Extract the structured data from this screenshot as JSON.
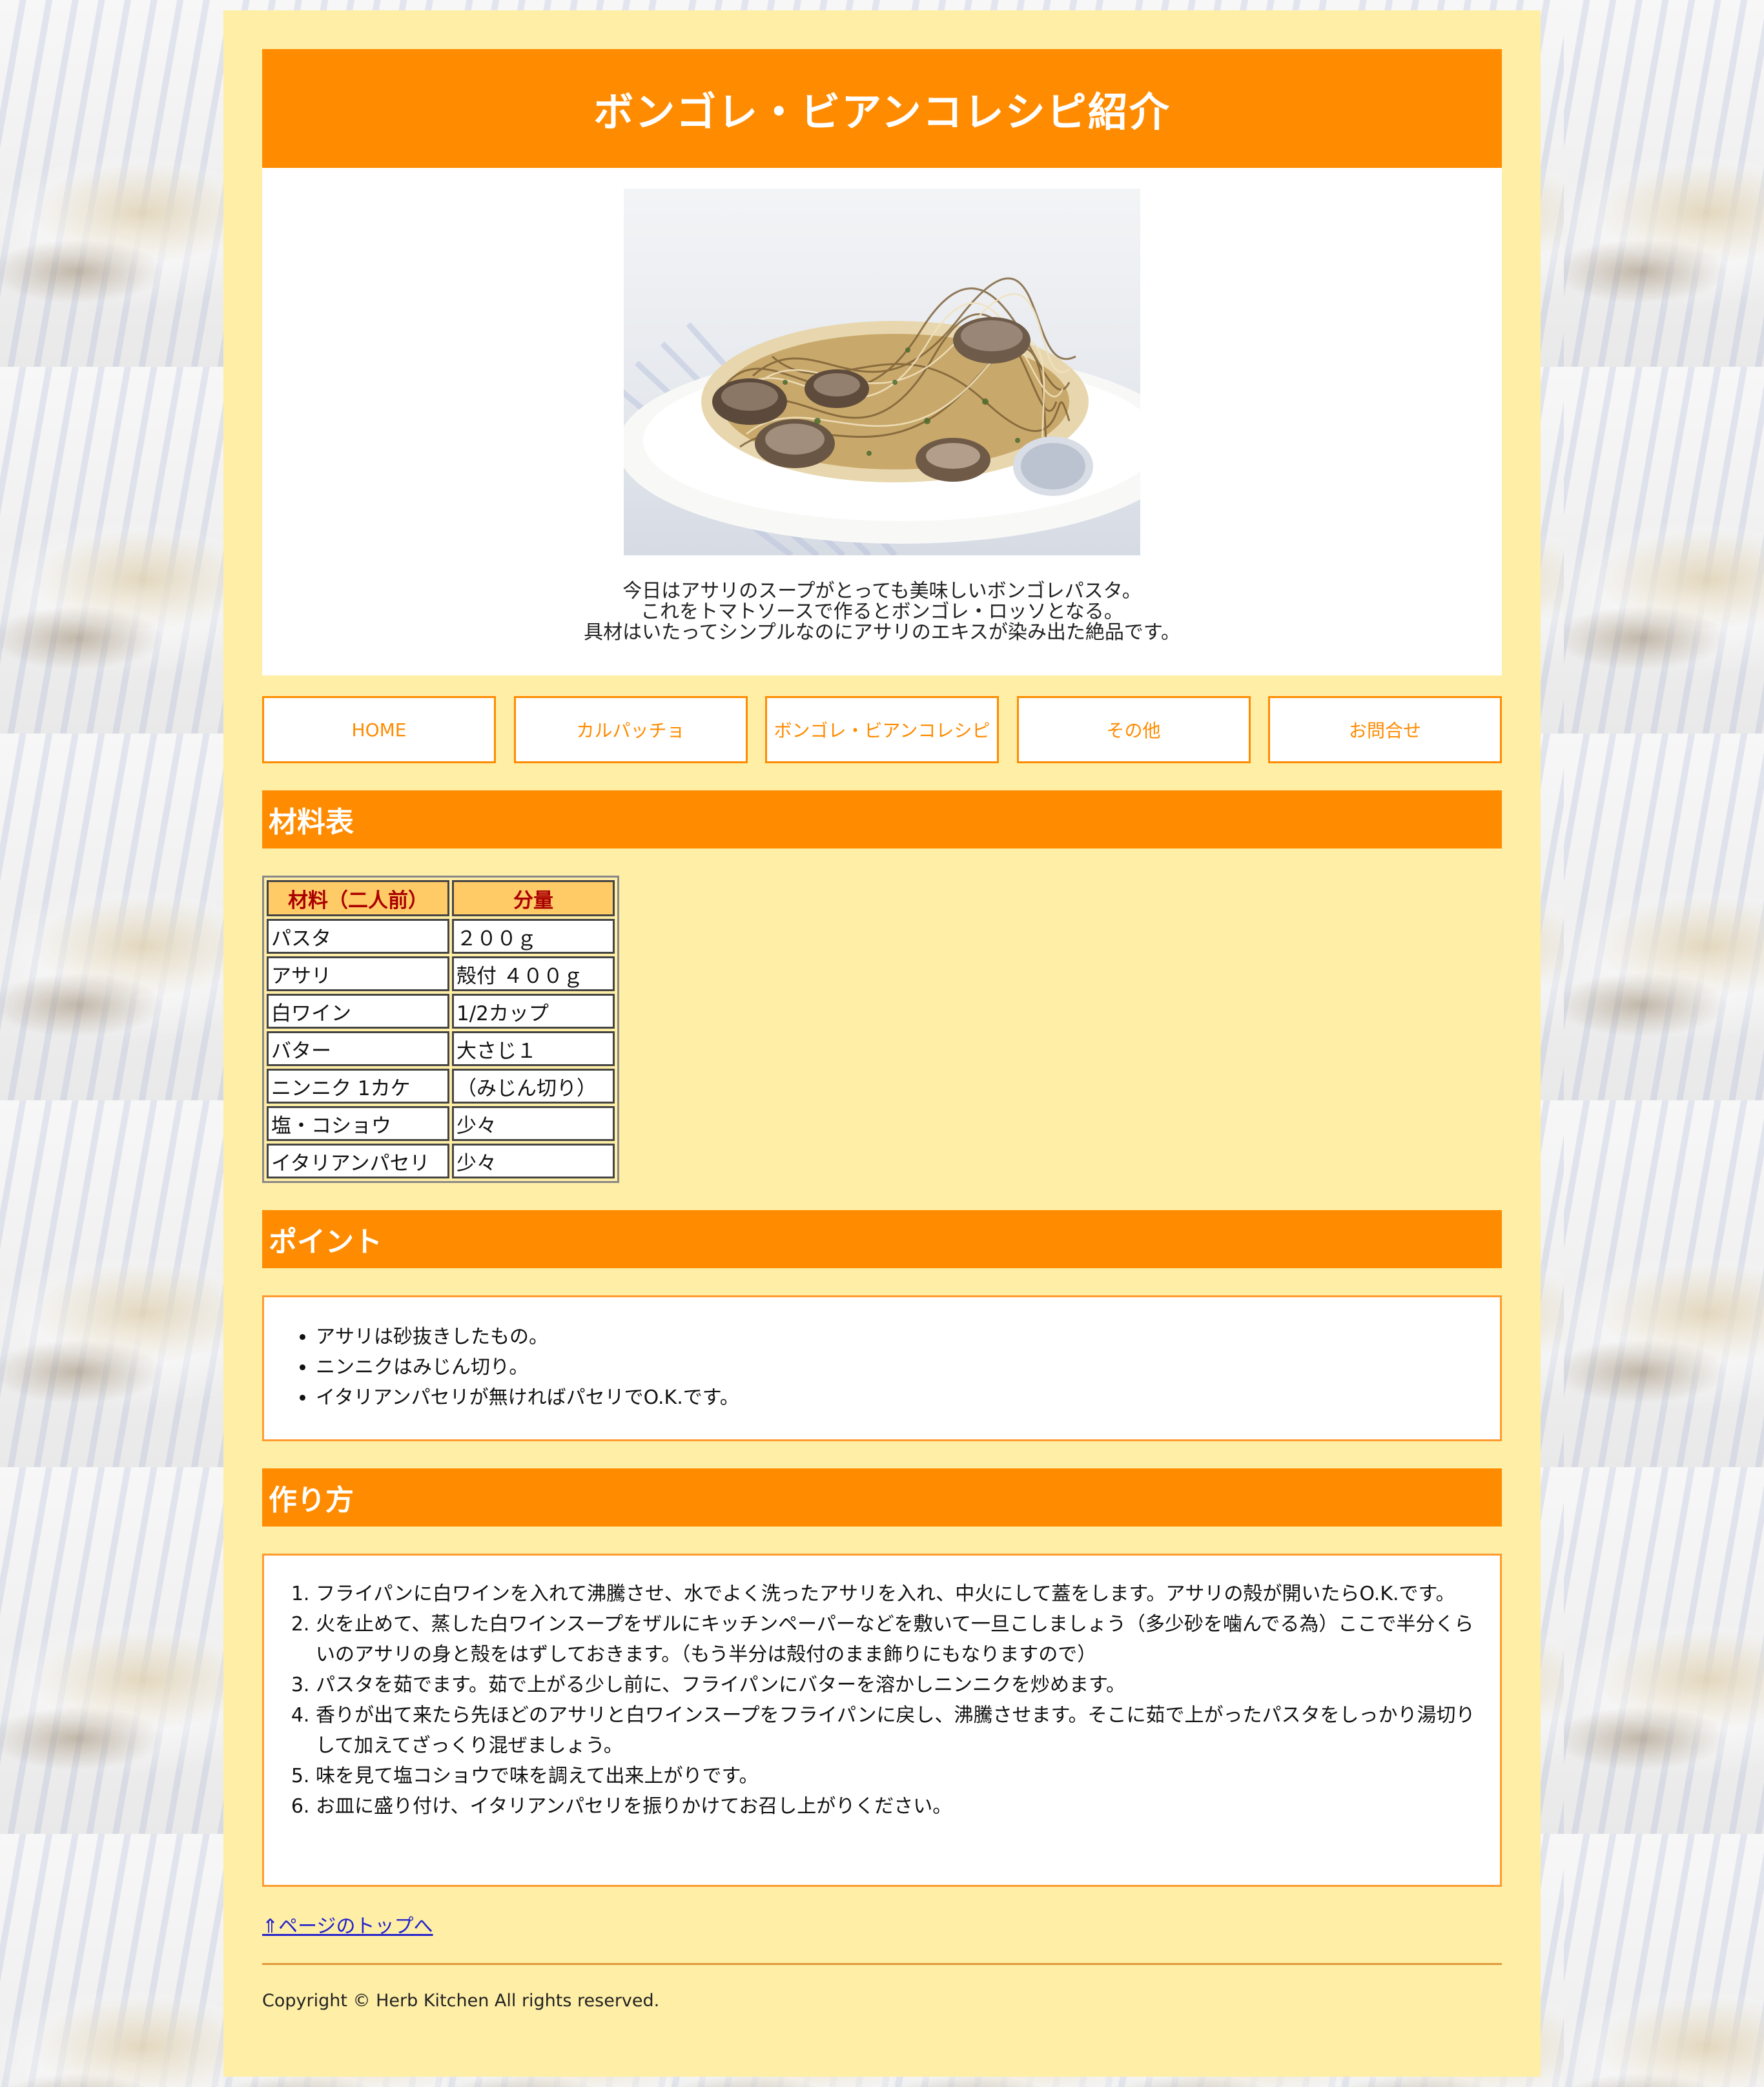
{
  "header": {
    "title": "ボンゴレ・ビアンコレシピ紹介"
  },
  "intro": {
    "lines": [
      "今日はアサリのスープがとっても美味しいボンゴレパスタ。",
      "これをトマトソースで作るとボンゴレ・ロッソとなる。",
      "具材はいたってシンプルなのにアサリのエキスが染み出た絶品です。"
    ]
  },
  "nav": {
    "items": [
      "HOME",
      "カルパッチョ",
      "ボンゴレ・ビアンコレシピ",
      "その他",
      "お問合せ"
    ]
  },
  "ingredients": {
    "heading": "材料表",
    "columns": [
      "材料（二人前）",
      "分量"
    ],
    "rows": [
      [
        "パスタ",
        "２００ｇ"
      ],
      [
        "アサリ",
        "殻付 ４００ｇ"
      ],
      [
        "白ワイン",
        "1/2カップ"
      ],
      [
        "バター",
        "大さじ１"
      ],
      [
        "ニンニク 1カケ",
        "（みじん切り）"
      ],
      [
        "塩・コショウ",
        "少々"
      ],
      [
        "イタリアンパセリ",
        "少々"
      ]
    ]
  },
  "points": {
    "heading": "ポイント",
    "items": [
      "アサリは砂抜きしたもの。",
      "ニンニクはみじん切り。",
      "イタリアンパセリが無ければパセリでO.K.です。"
    ]
  },
  "steps": {
    "heading": "作り方",
    "items": [
      "フライパンに白ワインを入れて沸騰させ、水でよく洗ったアサリを入れ、中火にして蓋をします。アサリの殻が開いたらO.K.です。",
      "火を止めて、蒸した白ワインスープをザルにキッチンペーパーなどを敷いて一旦こしましょう（多少砂を噛んでる為）ここで半分くらいのアサリの身と殻をはずしておきます。（もう半分は殻付のまま飾りにもなりますので）",
      "パスタを茹でます。茹で上がる少し前に、フライパンにバターを溶かしニンニクを炒めます。",
      "香りが出て来たら先ほどのアサリと白ワインスープをフライパンに戻し、沸騰させます。そこに茹で上がったパスタをしっかり湯切りして加えてざっくり混ぜましょう。",
      "味を見て塩コショウで味を調えて出来上がりです。",
      "お皿に盛り付け、イタリアンパセリを振りかけてお召し上がりください。"
    ]
  },
  "footer": {
    "pagetop": "⇑ページのトップへ",
    "copyright": "Copyright © Herb Kitchen All rights reserved."
  },
  "colors": {
    "accent": "#ff8b00",
    "page_background": "#ffeea6",
    "table_header": "#ffcb66",
    "table_header_text": "#aa0000",
    "link": "#2222cc"
  }
}
